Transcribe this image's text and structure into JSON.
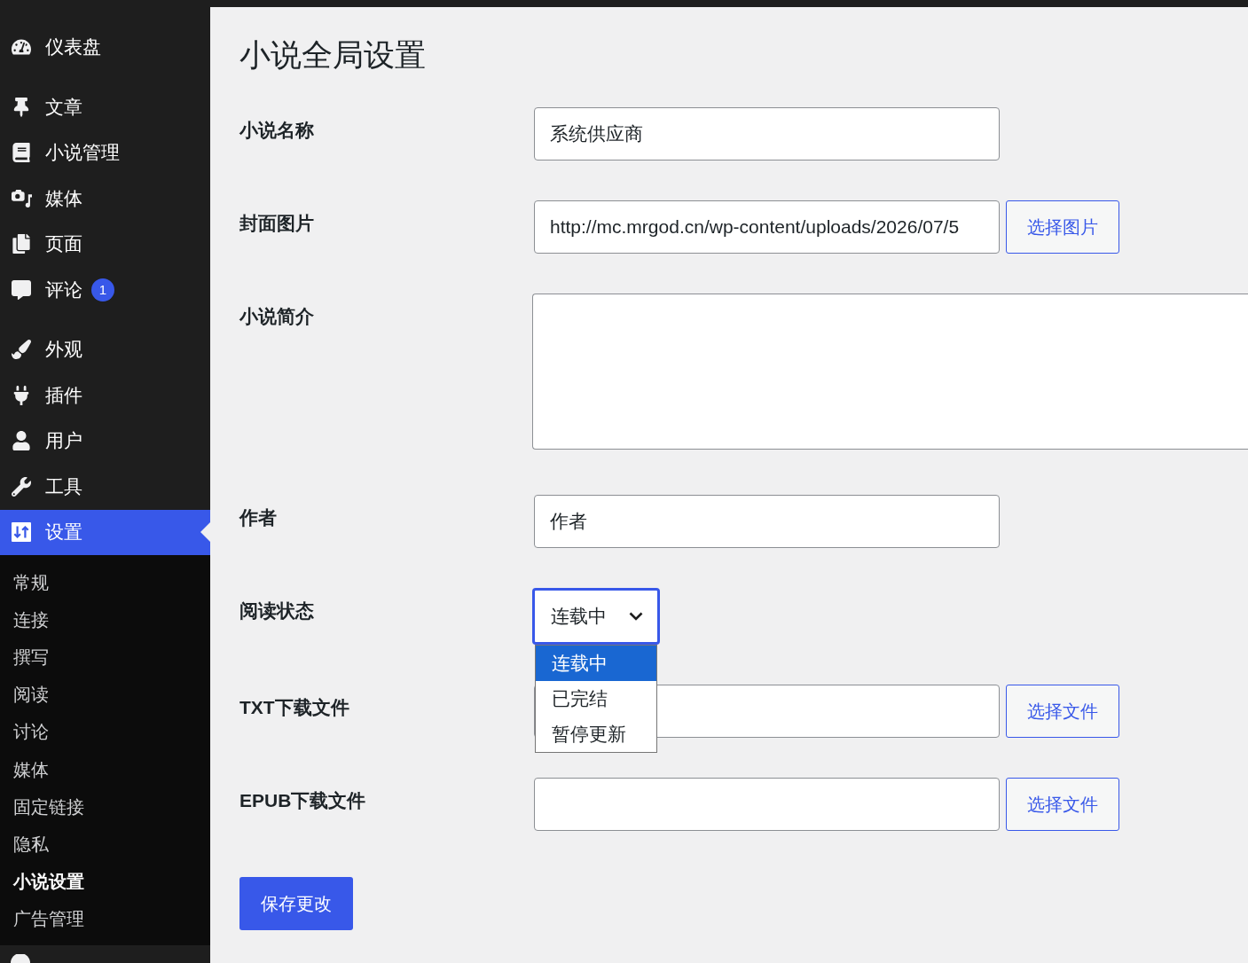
{
  "admin_menu": {
    "groups": [
      {
        "items": [
          {
            "label": "仪表盘",
            "selected": false
          }
        ]
      },
      {
        "items": [
          {
            "label": "文章",
            "selected": false
          },
          {
            "label": "小说管理",
            "selected": false
          },
          {
            "label": "媒体",
            "selected": false
          },
          {
            "label": "页面",
            "selected": false
          },
          {
            "label": "评论",
            "selected": false,
            "badge": "1"
          }
        ]
      },
      {
        "items": [
          {
            "label": "外观",
            "selected": false
          },
          {
            "label": "插件",
            "selected": false
          },
          {
            "label": "用户",
            "selected": false
          },
          {
            "label": "工具",
            "selected": false
          },
          {
            "label": "设置",
            "selected": true,
            "submenu": [
              {
                "label": "常规",
                "selected": false
              },
              {
                "label": "连接",
                "selected": false
              },
              {
                "label": "撰写",
                "selected": false
              },
              {
                "label": "阅读",
                "selected": false
              },
              {
                "label": "讨论",
                "selected": false
              },
              {
                "label": "媒体",
                "selected": false
              },
              {
                "label": "固定链接",
                "selected": false
              },
              {
                "label": "隐私",
                "selected": false
              },
              {
                "label": "小说设置",
                "selected": true
              },
              {
                "label": "广告管理",
                "selected": false
              }
            ]
          }
        ]
      }
    ]
  },
  "page": {
    "title": "小说全局设置",
    "fields": [
      {
        "kind": "text",
        "label": "小说名称",
        "value": "系统供应商"
      },
      {
        "kind": "media",
        "label": "封面图片",
        "value": "http://mc.mrgod.cn/wp-content/uploads/2026/07/5",
        "button": "选择图片"
      },
      {
        "kind": "textarea",
        "label": "小说简介"
      },
      {
        "kind": "text",
        "label": "作者",
        "value": "作者"
      },
      {
        "kind": "select",
        "label": "阅读状态",
        "value": "连载中",
        "focused": true,
        "expanded": true,
        "options": [
          {
            "label": "连载中",
            "selected": true
          },
          {
            "label": "已完结",
            "selected": false
          },
          {
            "label": "暂停更新",
            "selected": false
          }
        ]
      },
      {
        "kind": "media",
        "label": "TXT下载文件",
        "button": "选择文件"
      },
      {
        "kind": "media",
        "label": "EPUB下载文件",
        "button": "选择文件"
      }
    ],
    "submit": "保存更改"
  }
}
